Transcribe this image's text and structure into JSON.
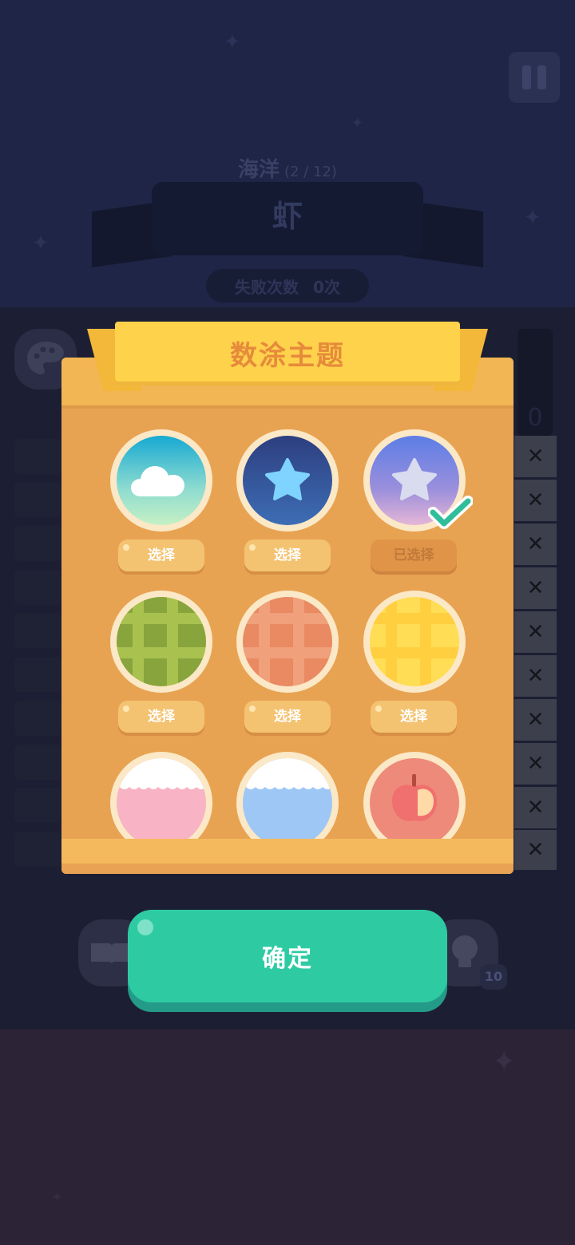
{
  "hud": {
    "category": "海洋",
    "progress": "(2 / 12)",
    "puzzle_name": "虾",
    "fail_label": "失败次数",
    "fail_count": "0次",
    "hint_count": "10"
  },
  "dialog": {
    "title": "数涂主题",
    "themes": [
      {
        "name": "cloud-sky",
        "button": "选择",
        "selected": false
      },
      {
        "name": "star-night",
        "button": "选择",
        "selected": false
      },
      {
        "name": "star-dusk",
        "button": "已选择",
        "selected": true
      },
      {
        "name": "green-plaid",
        "button": "选择",
        "selected": false
      },
      {
        "name": "orange-plaid",
        "button": "选择",
        "selected": false
      },
      {
        "name": "yellow-plaid",
        "button": "选择",
        "selected": false
      },
      {
        "name": "pink-lace",
        "button": "",
        "selected": false
      },
      {
        "name": "blue-lace",
        "button": "",
        "selected": false
      },
      {
        "name": "apple",
        "button": "",
        "selected": false
      }
    ],
    "confirm_label": "确定"
  },
  "colors": {
    "dialog_bg": "#e8a352",
    "banner": "#ffd24b",
    "confirm": "#2ecba3",
    "check": "#2fbd9a"
  }
}
